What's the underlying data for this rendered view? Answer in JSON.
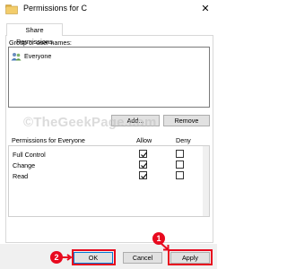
{
  "window": {
    "title": "Permissions for C",
    "close_glyph": "✕"
  },
  "tabs": [
    {
      "label": "Share Permissions"
    }
  ],
  "group_section": {
    "label": "Group or user names:",
    "items": [
      {
        "name": "Everyone",
        "icon": "users-icon"
      }
    ]
  },
  "buttons": {
    "add": "Add...",
    "remove": "Remove",
    "ok": "OK",
    "cancel": "Cancel",
    "apply": "Apply"
  },
  "permissions": {
    "label": "Permissions for Everyone",
    "allow_header": "Allow",
    "deny_header": "Deny",
    "rows": [
      {
        "name": "Full Control",
        "allow": true,
        "deny": false
      },
      {
        "name": "Change",
        "allow": true,
        "deny": false
      },
      {
        "name": "Read",
        "allow": true,
        "deny": false
      }
    ]
  },
  "annotations": {
    "badge_1": "1",
    "badge_2": "2",
    "highlight_color": "#e8091e"
  },
  "watermark": "©TheGeekPage.com"
}
